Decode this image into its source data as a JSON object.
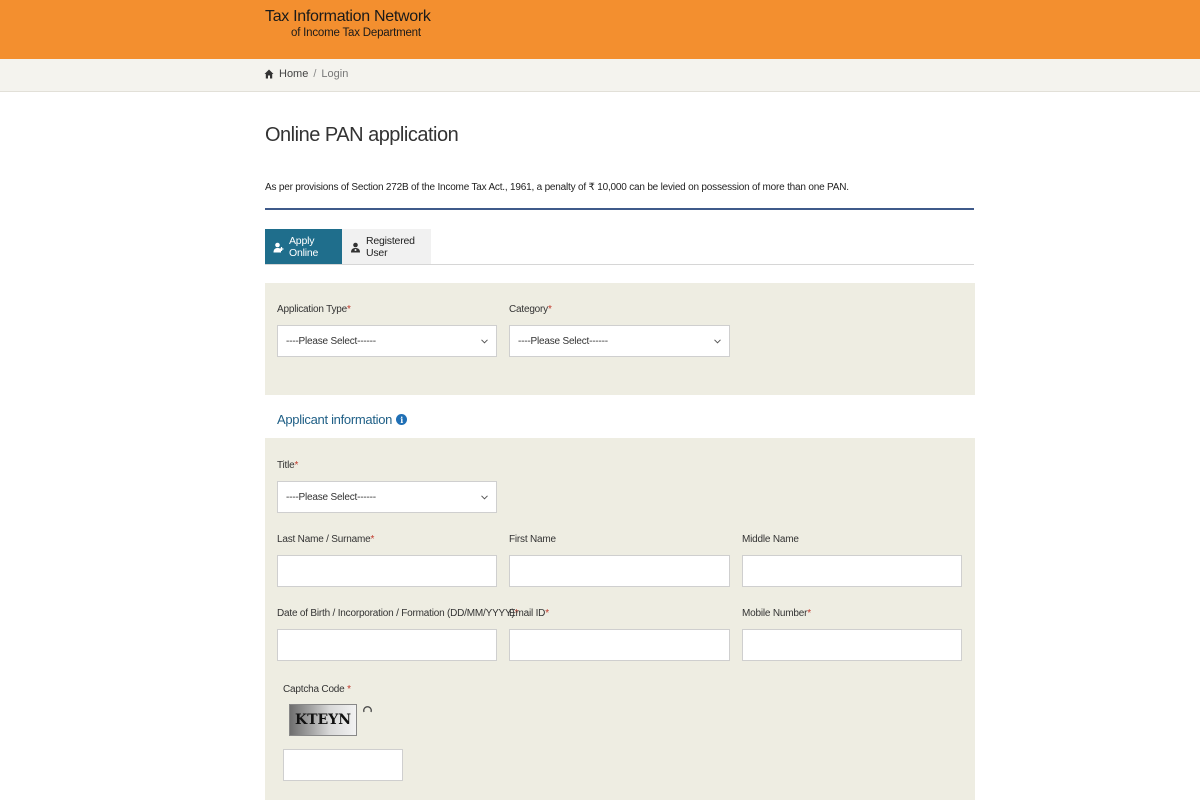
{
  "header": {
    "brand_line1": "Tax Information Network",
    "brand_line2": "of Income Tax Department",
    "bar_color": "#f38f2f"
  },
  "breadcrumb": {
    "home_icon": "home-icon",
    "home": "Home",
    "separator": "/",
    "current": "Login"
  },
  "page": {
    "title": "Online PAN application",
    "notice": "As per provisions of Section 272B of the Income Tax Act., 1961, a penalty of ₹ 10,000 can be levied on possession of more than one PAN."
  },
  "tabs": [
    {
      "label": "Apply Online",
      "active": true,
      "icon": "user-add-icon"
    },
    {
      "label": "Registered User",
      "active": false,
      "icon": "user-icon"
    }
  ],
  "form": {
    "application_type": {
      "label": "Application Type",
      "required_mark": "*",
      "value": "----Please Select------"
    },
    "category": {
      "label": "Category",
      "required_mark": "*",
      "value": "----Please Select------"
    },
    "applicant_section": {
      "title": "Applicant information",
      "icon": "info-icon",
      "icon_glyph": "i"
    },
    "title_field": {
      "label": "Title",
      "required_mark": "*",
      "value": "----Please Select------"
    },
    "last_name": {
      "label": "Last Name / Surname",
      "required_mark": "*",
      "value": ""
    },
    "first_name": {
      "label": "First Name",
      "value": ""
    },
    "middle_name": {
      "label": "Middle Name",
      "value": ""
    },
    "dob": {
      "label": "Date of Birth / Incorporation / Formation (DD/MM/YYYY)",
      "required_mark": "*",
      "value": ""
    },
    "email": {
      "label": "Email ID",
      "required_mark": "*",
      "value": ""
    },
    "mobile": {
      "label": "Mobile Number",
      "required_mark": "*",
      "value": ""
    },
    "captcha": {
      "label": "Captcha Code",
      "required_mark": " *",
      "image_text": "KTEYN",
      "refresh_icon": "refresh-icon",
      "value": ""
    }
  },
  "colors": {
    "accent": "#1f6e8c",
    "panel": "#eeede2",
    "required": "#c0392b",
    "section_heading": "#1f5f86"
  }
}
